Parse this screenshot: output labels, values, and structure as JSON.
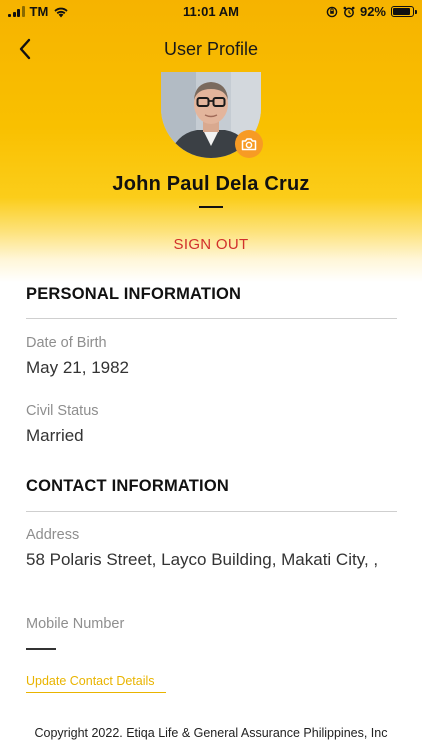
{
  "status_bar": {
    "carrier": "TM",
    "time": "11:01 AM",
    "battery_percent": "92%",
    "battery_level": 0.92
  },
  "header": {
    "title": "User Profile"
  },
  "profile": {
    "name": "John Paul Dela Cruz",
    "sign_out_label": "SIGN OUT"
  },
  "personal": {
    "section_title": "PERSONAL INFORMATION",
    "dob_label": "Date of Birth",
    "dob_value": "May 21, 1982",
    "civil_label": "Civil Status",
    "civil_value": "Married"
  },
  "contact": {
    "section_title": "CONTACT INFORMATION",
    "address_label": "Address",
    "address_value": "58 Polaris Street, Layco Building, Makati City, ,",
    "mobile_label": "Mobile Number",
    "update_link": "Update Contact Details"
  },
  "footer": {
    "copyright": "Copyright 2022. Etiqa Life & General Assurance Philippines, Inc"
  },
  "colors": {
    "accent_yellow": "#f9c000",
    "sign_out_red": "#d1302b",
    "camera_orange": "#f79b24",
    "link_yellow": "#e9b400"
  },
  "icons": [
    "signal-icon",
    "wifi-icon",
    "orientation-lock-icon",
    "alarm-icon",
    "battery-icon",
    "back-arrow-icon",
    "camera-icon"
  ]
}
